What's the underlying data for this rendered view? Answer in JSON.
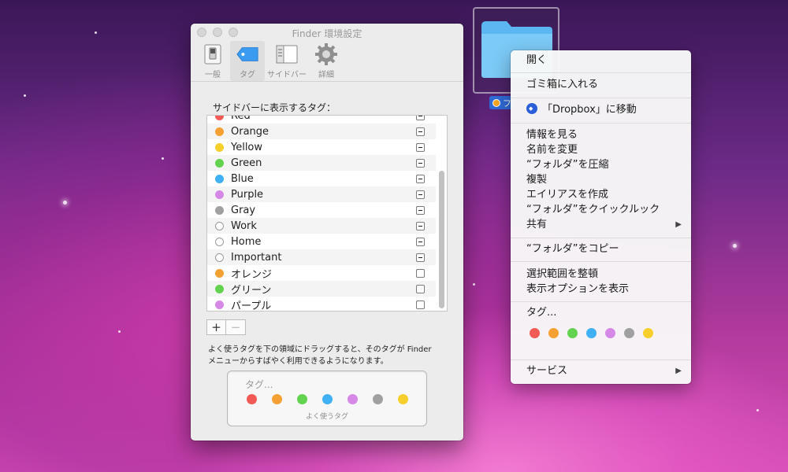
{
  "prefs_window": {
    "title": "Finder 環境設定",
    "tabs": [
      "一般",
      "タグ",
      "サイドバー",
      "詳細"
    ],
    "section_label": "サイドバーに表示するタグ：",
    "tags": [
      {
        "name": "Red",
        "color": "#f25a55",
        "state": "mixed"
      },
      {
        "name": "Orange",
        "color": "#f5a033",
        "state": "mixed"
      },
      {
        "name": "Yellow",
        "color": "#f6cf2c",
        "state": "mixed"
      },
      {
        "name": "Green",
        "color": "#63d24f",
        "state": "mixed"
      },
      {
        "name": "Blue",
        "color": "#3fb0f3",
        "state": "mixed"
      },
      {
        "name": "Purple",
        "color": "#d588e6",
        "state": "mixed"
      },
      {
        "name": "Gray",
        "color": "#a0a0a0",
        "state": "mixed"
      },
      {
        "name": "Work",
        "color": "",
        "state": "mixed"
      },
      {
        "name": "Home",
        "color": "",
        "state": "mixed"
      },
      {
        "name": "Important",
        "color": "",
        "state": "mixed"
      },
      {
        "name": "オレンジ",
        "color": "#f5a033",
        "state": "unchecked"
      },
      {
        "name": "グリーン",
        "color": "#63d24f",
        "state": "unchecked"
      },
      {
        "name": "パープル",
        "color": "#d588e6",
        "state": "unchecked"
      }
    ],
    "add_label": "+",
    "remove_label": "−",
    "help_line1": "よく使うタグを下の領域にドラッグすると、そのタグが Finder",
    "help_line2": "メニューからすばやく利用できるようになります。",
    "favorites_title": "タグ...",
    "favorites_caption": "よく使うタグ",
    "favorite_colors": [
      "#f25a55",
      "#f5a033",
      "#63d24f",
      "#3fb0f3",
      "#d588e6",
      "#a0a0a0",
      "#f6cf2c"
    ]
  },
  "desktop_folder": {
    "label": "フ"
  },
  "context_menu": {
    "open": "開く",
    "trash": "ゴミ箱に入れる",
    "dropbox": "「Dropbox」に移動",
    "get_info": "情報を見る",
    "rename": "名前を変更",
    "compress": "“フォルダ”を圧縮",
    "duplicate": "複製",
    "make_alias": "エイリアスを作成",
    "quicklook": "“フォルダ”をクイックルック",
    "share": "共有",
    "copy": "“フォルダ”をコピー",
    "clean_up": "選択範囲を整頓",
    "view_options": "表示オプションを表示",
    "tags": "タグ...",
    "tag_colors": [
      "#f25a55",
      "#f5a033",
      "#63d24f",
      "#3fb0f3",
      "#d588e6",
      "#a0a0a0",
      "#f6cf2c"
    ],
    "services": "サービス"
  }
}
